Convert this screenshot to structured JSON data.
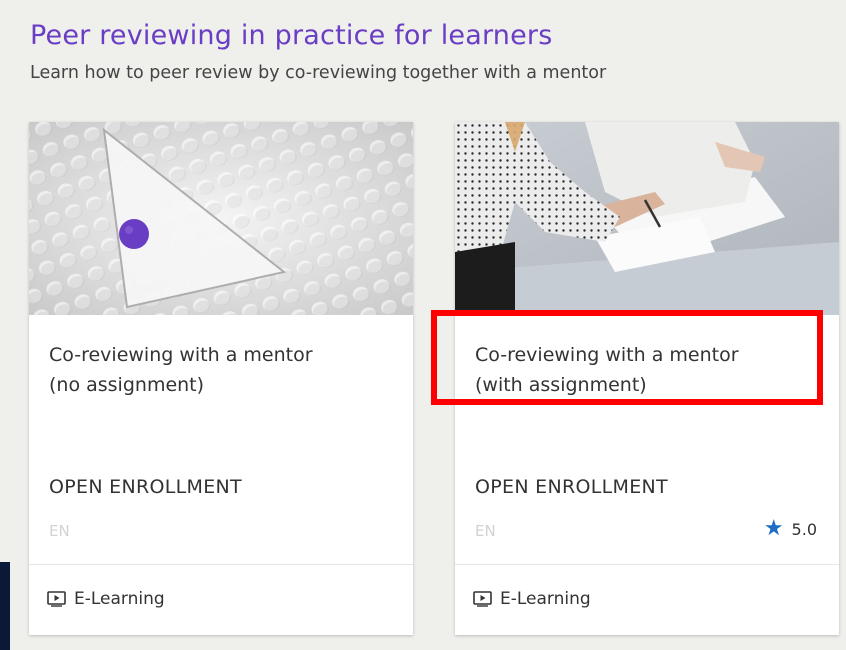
{
  "section": {
    "title": "Peer reviewing in practice for learners",
    "subtitle": "Learn how to peer review by co-reviewing together with a mentor"
  },
  "courses": [
    {
      "title_line1": "Co-reviewing with a mentor",
      "title_line2": "(no assignment)",
      "status": "OPEN ENROLLMENT",
      "language": "EN",
      "rating": "",
      "format": "E-Learning",
      "format_icon": "play-screen-icon"
    },
    {
      "title_line1": "Co-reviewing with a mentor",
      "title_line2": "(with assignment)",
      "status": "OPEN ENROLLMENT",
      "language": "EN",
      "rating": "5.0",
      "rating_icon": "star-icon",
      "format": "E-Learning",
      "format_icon": "play-screen-icon"
    }
  ],
  "colors": {
    "title": "#6a3ec4",
    "star": "#1f6cc4",
    "highlight": "#ff0000",
    "background": "#efefec"
  }
}
